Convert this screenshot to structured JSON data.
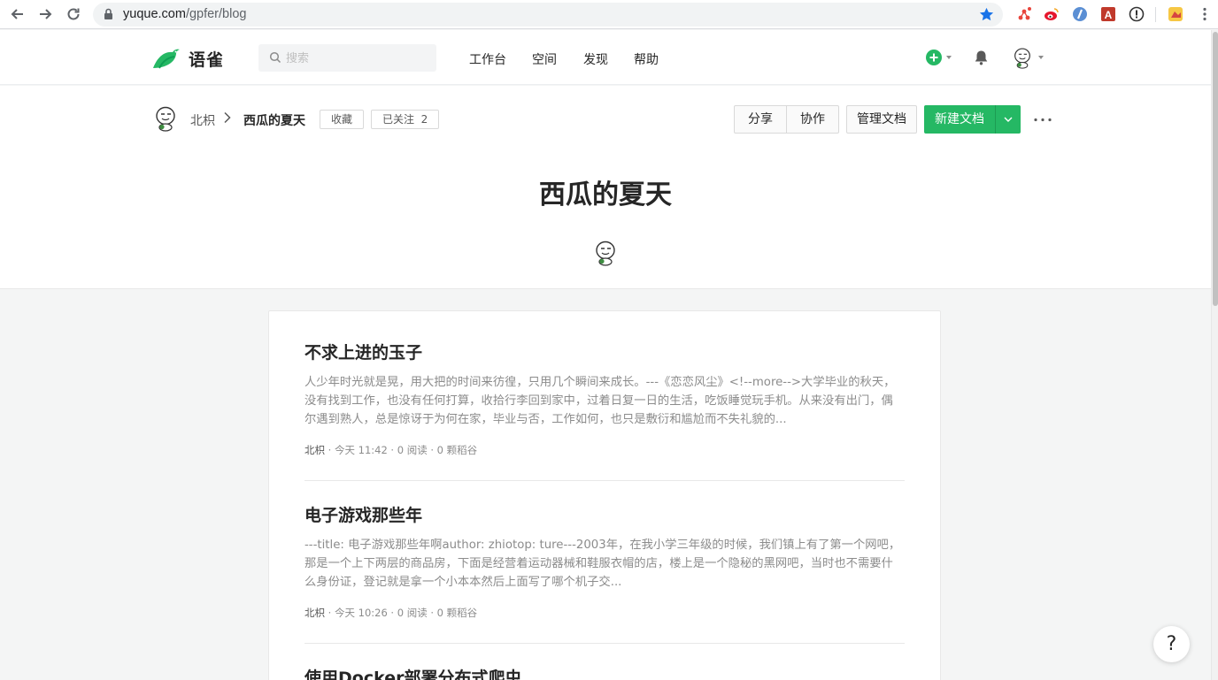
{
  "browser": {
    "url_host": "yuque.com",
    "url_path": "/gpfer/blog"
  },
  "header": {
    "logo_text": "语雀",
    "search_placeholder": "搜索",
    "nav": [
      "工作台",
      "空间",
      "发现",
      "帮助"
    ]
  },
  "book": {
    "breadcrumb_user": "北枳",
    "breadcrumb_book": "西瓜的夏天",
    "favorite_label": "收藏",
    "follow_label": "已关注",
    "follow_count": "2",
    "share_label": "分享",
    "collaborate_label": "协作",
    "manage_label": "管理文档",
    "new_doc_label": "新建文档",
    "title": "西瓜的夏天"
  },
  "docs": [
    {
      "title": "不求上进的玉子",
      "abstract": "人少年时光就是晃，用大把的时间来彷徨，只用几个瞬间来成长。---《恋恋风尘》<!--more-->大学毕业的秋天，没有找到工作，也没有任何打算，收拾行李回到家中，过着日复一日的生活，吃饭睡觉玩手机。从来没有出门，偶尔遇到熟人，总是惊讶于为何在家，毕业与否，工作如何，也只是敷衍和尴尬而不失礼貌的...",
      "author": "北枳",
      "meta": " · 今天 11:42 · 0 阅读 · 0 颗稻谷"
    },
    {
      "title": "电子游戏那些年",
      "abstract": "---title: 电子游戏那些年啊author: zhiotop: ture---2003年，在我小学三年级的时候，我们镇上有了第一个网吧，那是一个上下两层的商品房，下面是经营着运动器械和鞋服衣帽的店，楼上是一个隐秘的黑网吧，当时也不需要什么身份证，登记就是拿一个小本本然后上面写了哪个机子交...",
      "author": "北枳",
      "meta": " · 今天 10:26 · 0 阅读 · 0 颗稻谷"
    },
    {
      "title": "使用Docker部署分布式爬虫",
      "abstract": "",
      "author": "",
      "meta": ""
    }
  ],
  "help": {
    "label": "?"
  },
  "colors": {
    "brand_green": "#25b864",
    "text": "#262626",
    "muted": "#8c8c8c"
  }
}
